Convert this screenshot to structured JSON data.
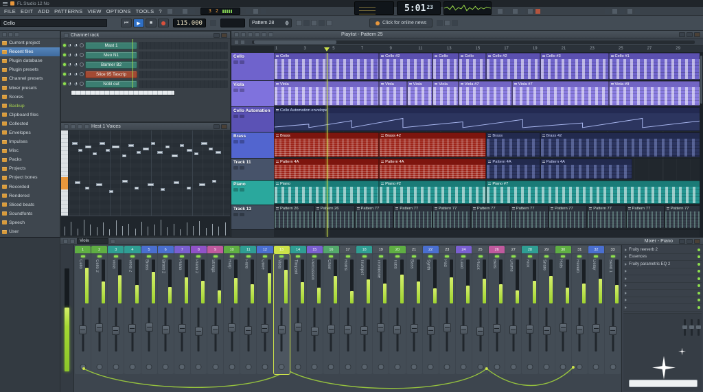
{
  "window": {
    "title": "FL Studio 12 No"
  },
  "menu": {
    "items": [
      "FILE",
      "EDIT",
      "ADD",
      "PATTERNS",
      "VIEW",
      "OPTIONS",
      "TOOLS",
      "?"
    ]
  },
  "transport": {
    "time_main": "5:01",
    "time_frac": "23",
    "tempo": "115.000",
    "cpu_left": "3",
    "cpu_right": "2",
    "name_field": "Cello",
    "pattern_selector": "Pattern 28",
    "news_label": "Click for online news"
  },
  "browser": {
    "items": [
      {
        "label": "Current project"
      },
      {
        "label": "Recent files",
        "selected": true
      },
      {
        "label": "Plugin database"
      },
      {
        "label": "Plugin presets"
      },
      {
        "label": "Channel presets"
      },
      {
        "label": "Mixer presets"
      },
      {
        "label": "Scores"
      },
      {
        "label": "Backup",
        "accent": true
      },
      {
        "label": "Clipboard files"
      },
      {
        "label": "Collected"
      },
      {
        "label": "Envelopes"
      },
      {
        "label": "Impulses"
      },
      {
        "label": "Misc"
      },
      {
        "label": "Packs"
      },
      {
        "label": "Projects"
      },
      {
        "label": "Project bones"
      },
      {
        "label": "Recorded"
      },
      {
        "label": "Rendered"
      },
      {
        "label": "Sliced beats"
      },
      {
        "label": "Soundfonts"
      },
      {
        "label": "Speech"
      },
      {
        "label": "User"
      }
    ]
  },
  "channel_rack": {
    "title": "Channel rack",
    "channels": [
      {
        "name": "Mast 1",
        "color": "#3b7e71"
      },
      {
        "name": "Meo N1",
        "color": "#3b7e71"
      },
      {
        "name": "Barmer B2",
        "color": "#3b7e71"
      },
      {
        "name": "Slice 95 Tascrip",
        "color": "#a34a33"
      },
      {
        "name": "Nobl out",
        "color": "#3b7e71"
      }
    ]
  },
  "piano_roll": {
    "title": "Hest 1 Voices",
    "notes": [
      [
        2,
        14,
        8
      ],
      [
        6,
        22,
        6
      ],
      [
        10,
        18,
        9
      ],
      [
        15,
        26,
        6
      ],
      [
        19,
        14,
        8
      ],
      [
        23,
        22,
        6
      ],
      [
        27,
        18,
        11
      ],
      [
        33,
        28,
        6
      ],
      [
        37,
        16,
        8
      ],
      [
        42,
        24,
        6
      ],
      [
        46,
        20,
        9
      ],
      [
        51,
        14,
        6
      ],
      [
        55,
        24,
        8
      ],
      [
        60,
        18,
        6
      ],
      [
        64,
        28,
        9
      ],
      [
        69,
        16,
        6
      ],
      [
        73,
        22,
        8
      ],
      [
        78,
        26,
        6
      ],
      [
        82,
        14,
        9
      ],
      [
        87,
        20,
        6
      ],
      [
        91,
        24,
        8
      ],
      [
        4,
        60,
        8
      ],
      [
        10,
        66,
        6
      ],
      [
        17,
        62,
        9
      ],
      [
        25,
        70,
        6
      ],
      [
        33,
        58,
        8
      ],
      [
        41,
        66,
        6
      ],
      [
        49,
        62,
        9
      ],
      [
        57,
        68,
        6
      ],
      [
        65,
        60,
        8
      ],
      [
        73,
        66,
        6
      ],
      [
        81,
        62,
        9
      ],
      [
        89,
        58,
        6
      ]
    ],
    "velocity": [
      45,
      70,
      35,
      80,
      55,
      40,
      65,
      30,
      75,
      50,
      60,
      35,
      70,
      45,
      55,
      80,
      40,
      60,
      30,
      65,
      50,
      72,
      38,
      58,
      46,
      66
    ]
  },
  "playlist": {
    "title": "Playlist - Pattern 25",
    "ruler": [
      "1",
      "3",
      "5",
      "7",
      "9",
      "11",
      "13",
      "15",
      "17",
      "19",
      "21",
      "23",
      "25",
      "27",
      "29"
    ],
    "playhead_pct": 12.35,
    "tracks": [
      {
        "name": "Cello",
        "color": "#6f63cc",
        "height": 41,
        "clips": [
          {
            "label": "Cello",
            "start": 0,
            "end": 24.5,
            "kind": "purple"
          },
          {
            "label": "Cello #2",
            "start": 24.5,
            "end": 37,
            "kind": "purple"
          },
          {
            "label": "Cello",
            "start": 37,
            "end": 43,
            "kind": "purple"
          },
          {
            "label": "Cello",
            "start": 43,
            "end": 49.5,
            "kind": "purple"
          },
          {
            "label": "Cello #2",
            "start": 49.5,
            "end": 62,
            "kind": "purple"
          },
          {
            "label": "Cello #3",
            "start": 62,
            "end": 78,
            "kind": "purple"
          },
          {
            "label": "Cello #1",
            "start": 78,
            "end": 100,
            "kind": "purple"
          }
        ]
      },
      {
        "name": "Viola",
        "color": "#7f72dd",
        "height": 38,
        "clips": [
          {
            "label": "Viola",
            "start": 0,
            "end": 24.5,
            "kind": "viola"
          },
          {
            "label": "Viola",
            "start": 24.5,
            "end": 31,
            "kind": "viola"
          },
          {
            "label": "Viola",
            "start": 31,
            "end": 37,
            "kind": "viola"
          },
          {
            "label": "Viola",
            "start": 37,
            "end": 43,
            "kind": "viola"
          },
          {
            "label": "Viola #7",
            "start": 43,
            "end": 55.5,
            "kind": "viola"
          },
          {
            "label": "Viola #7",
            "start": 55.5,
            "end": 78,
            "kind": "viola"
          },
          {
            "label": "Viola #9",
            "start": 78,
            "end": 100,
            "kind": "viola"
          }
        ]
      },
      {
        "name": "Cello Automation",
        "color": "#5b52b5",
        "height": 37,
        "clips": [
          {
            "label": "Cello Automation envelope",
            "start": 0,
            "end": 100,
            "kind": "automation"
          }
        ]
      },
      {
        "name": "Brass",
        "color": "#5265cf",
        "height": 38,
        "clips": [
          {
            "label": "Brass",
            "start": 0,
            "end": 24.5,
            "kind": "red"
          },
          {
            "label": "Brass 42",
            "start": 24.5,
            "end": 49.5,
            "kind": "red"
          },
          {
            "label": "Brass",
            "start": 49.5,
            "end": 62,
            "kind": "navy"
          },
          {
            "label": "Brass 42",
            "start": 62,
            "end": 100,
            "kind": "navy"
          }
        ]
      },
      {
        "name": "Track 11",
        "color": "#47536a",
        "height": 32,
        "clips": [
          {
            "label": "Pattern 4A",
            "start": 0,
            "end": 24.5,
            "kind": "red"
          },
          {
            "label": "Pattern 4A",
            "start": 24.5,
            "end": 49.5,
            "kind": "red"
          },
          {
            "label": "Pattern 4A",
            "start": 49.5,
            "end": 62,
            "kind": "navy"
          },
          {
            "label": "Pattern 4A",
            "start": 62,
            "end": 83.5,
            "kind": "navy"
          }
        ]
      },
      {
        "name": "Piano",
        "color": "#2aa89d",
        "height": 36,
        "clips": [
          {
            "label": "Piano",
            "start": 0,
            "end": 24.5,
            "kind": "teal"
          },
          {
            "label": "Piano #2",
            "start": 24.5,
            "end": 49.5,
            "kind": "teal"
          },
          {
            "label": "Piano #7",
            "start": 49.5,
            "end": 100,
            "kind": "teal"
          }
        ]
      },
      {
        "name": "Track 13",
        "color": "#414c5c",
        "height": 36,
        "clips": [
          {
            "label": "Pattern 26",
            "start": 0,
            "end": 9.4,
            "kind": "gray"
          },
          {
            "label": "Pattern 26",
            "start": 9.4,
            "end": 18.8,
            "kind": "gray"
          },
          {
            "label": "Pattern 77",
            "start": 18.8,
            "end": 27.9,
            "kind": "gray"
          },
          {
            "label": "Pattern 77",
            "start": 27.9,
            "end": 36.9,
            "kind": "gray"
          },
          {
            "label": "Pattern 77",
            "start": 36.9,
            "end": 45.9,
            "kind": "gray"
          },
          {
            "label": "Pattern 77",
            "start": 45.9,
            "end": 55,
            "kind": "gray"
          },
          {
            "label": "Pattern 77",
            "start": 55,
            "end": 64,
            "kind": "gray"
          },
          {
            "label": "Pattern 77",
            "start": 64,
            "end": 73,
            "kind": "gray"
          },
          {
            "label": "Pattern 77",
            "start": 73,
            "end": 82,
            "kind": "gray"
          },
          {
            "label": "Pattern 77",
            "start": 82,
            "end": 91,
            "kind": "gray"
          },
          {
            "label": "Pattern 77",
            "start": 91,
            "end": 100,
            "kind": "gray"
          }
        ]
      }
    ]
  },
  "mixer": {
    "title": "Mixer - Piano",
    "selected_track_label": "Viola",
    "selected_index": 12,
    "tab_colors": [
      "#5fae43",
      "#5fae43",
      "#2f9e93",
      "#2f9e93",
      "#4a6fd0",
      "#4a6fd0",
      "#7a5fd0",
      "#9052c8",
      "#c05a9e",
      "#5fae43",
      "#2f9e93",
      "#4a6fd0",
      "#cde24a",
      "#2f9e93",
      "#7a5fd0",
      "#53a86b",
      "#4a525a",
      "#2f9e93",
      "#4a525a",
      "#5fae43",
      "#4a525a",
      "#4a6fd0",
      "#4a525a",
      "#7a5fd0",
      "#4a525a",
      "#c05a9e",
      "#4a525a",
      "#2f9e93",
      "#4a525a",
      "#5fae43",
      "#4a525a",
      "#4a6fd0",
      "#4a525a"
    ],
    "strip_names": [
      "Cello",
      "Cello 2",
      "Viola",
      "Viola 2",
      "Brass",
      "Brass 2",
      "Piano",
      "Piano 2",
      "Strings",
      "Harp",
      "Flute",
      "Oboe",
      "Viola",
      "Timpani",
      "Percussion",
      "Choir",
      "Horns",
      "Trumpet",
      "Trombone",
      "Tuba",
      "Bass",
      "Synth",
      "Pad",
      "Lead",
      "Pluck",
      "Bells",
      "Drums",
      "Kick",
      "Snare",
      "Hats",
      "Reverb",
      "Delay",
      "Send 1"
    ],
    "levels": [
      0.82,
      0.5,
      0.64,
      0.42,
      0.72,
      0.38,
      0.6,
      0.52,
      0.3,
      0.58,
      0.44,
      0.68,
      0.76,
      0.48,
      0.36,
      0.62,
      0.28,
      0.54,
      0.46,
      0.66,
      0.5,
      0.34,
      0.6,
      0.4,
      0.56,
      0.44,
      0.3,
      0.52,
      0.62,
      0.36,
      0.46,
      0.56,
      0.42
    ],
    "faders": [
      0.5,
      0.46,
      0.52,
      0.48,
      0.44,
      0.5,
      0.47,
      0.54,
      0.5,
      0.45,
      0.52,
      0.48,
      0.5,
      0.43,
      0.55,
      0.49,
      0.5,
      0.53,
      0.46,
      0.5,
      0.48,
      0.52,
      0.45,
      0.5,
      0.54,
      0.47,
      0.5,
      0.49,
      0.53,
      0.46,
      0.5,
      0.48,
      0.52
    ],
    "fx_panel": {
      "slots": [
        {
          "label": "Fruity reeverb 2",
          "on": true
        },
        {
          "label": "Essences",
          "on": true
        },
        {
          "label": "Fruity parametric EQ 2",
          "on": true
        },
        {
          "label": "",
          "on": true
        },
        {
          "label": "",
          "on": true
        },
        {
          "label": "",
          "on": true
        },
        {
          "label": "",
          "on": true
        },
        {
          "label": "",
          "on": true
        },
        {
          "label": "",
          "on": true
        }
      ]
    }
  }
}
